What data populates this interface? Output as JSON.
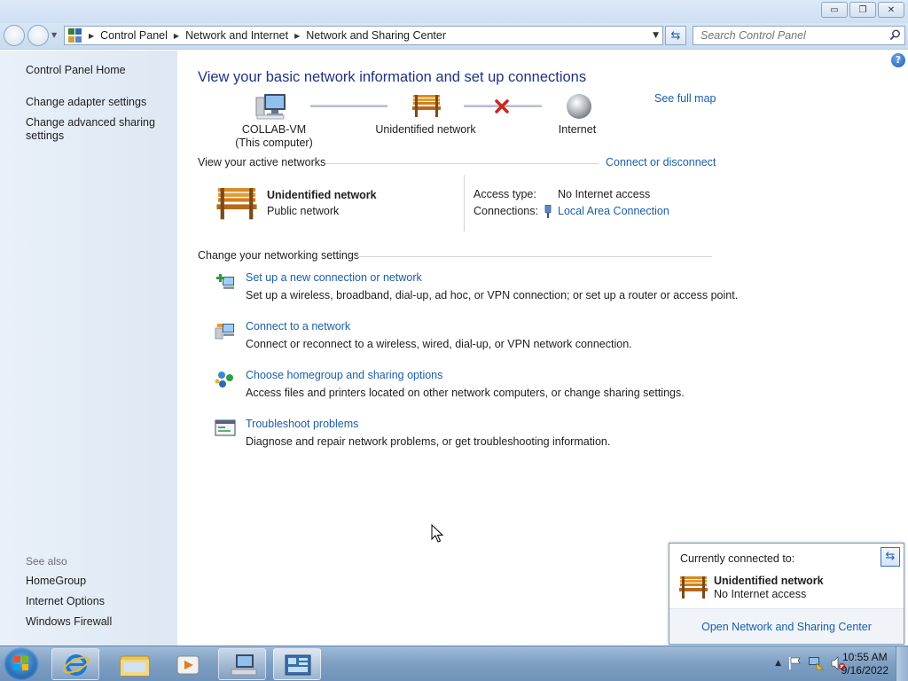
{
  "window": {
    "minimize_label": "▭",
    "restore_label": "❐",
    "close_label": "✕"
  },
  "address": {
    "crumbs": [
      "Control Panel",
      "Network and Internet",
      "Network and Sharing Center"
    ],
    "search_placeholder": "Search Control Panel"
  },
  "sidebar": {
    "home": "Control Panel Home",
    "links": [
      "Change adapter settings",
      "Change advanced sharing settings"
    ],
    "see_also_heading": "See also",
    "see_also": [
      "HomeGroup",
      "Internet Options",
      "Windows Firewall"
    ]
  },
  "main": {
    "title": "View your basic network information and set up connections",
    "see_full_map": "See full map",
    "map": {
      "computer_name": "COLLAB-VM",
      "computer_sub": "(This computer)",
      "network": "Unidentified network",
      "internet": "Internet"
    },
    "active_networks": {
      "heading": "View your active networks",
      "connect_link": "Connect or disconnect",
      "network_name": "Unidentified network",
      "network_type": "Public network",
      "access_type_label": "Access type:",
      "access_type_value": "No Internet access",
      "connections_label": "Connections:",
      "connections_value": "Local Area Connection"
    },
    "settings": {
      "heading": "Change your networking settings",
      "items": [
        {
          "title": "Set up a new connection or network",
          "desc": "Set up a wireless, broadband, dial-up, ad hoc, or VPN connection; or set up a router or access point.",
          "icon": "new-connection-icon"
        },
        {
          "title": "Connect to a network",
          "desc": "Connect or reconnect to a wireless, wired, dial-up, or VPN network connection.",
          "icon": "connect-network-icon"
        },
        {
          "title": "Choose homegroup and sharing options",
          "desc": "Access files and printers located on other network computers, or change sharing settings.",
          "icon": "homegroup-icon"
        },
        {
          "title": "Troubleshoot problems",
          "desc": "Diagnose and repair network problems, or get troubleshooting information.",
          "icon": "troubleshoot-icon"
        }
      ]
    }
  },
  "flyout": {
    "heading": "Currently connected to:",
    "network_name": "Unidentified network",
    "network_status": "No Internet access",
    "open_link": "Open Network and Sharing Center"
  },
  "taskbar": {
    "time": "10:55 AM",
    "date": "9/16/2022"
  },
  "colors": {
    "link": "#1a5ea6",
    "title": "#1e3287",
    "sidebar_bg": "#dde8f4",
    "error_x": "#d0231e"
  }
}
